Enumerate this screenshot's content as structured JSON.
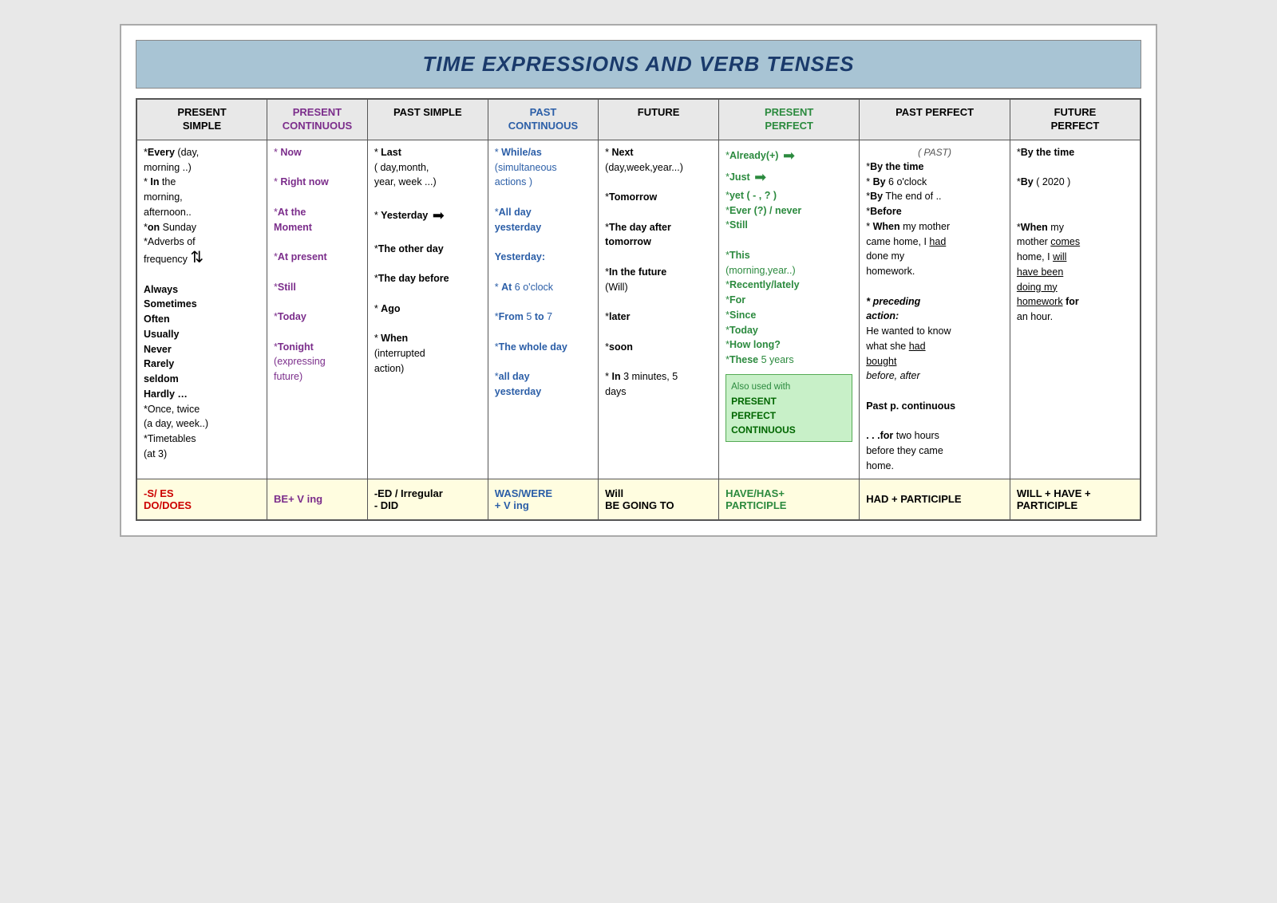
{
  "title": "TIME EXPRESSIONS AND VERB TENSES",
  "columns": [
    {
      "id": "present_simple",
      "header1": "PRESENT",
      "header2": "SIMPLE",
      "color": "#000"
    },
    {
      "id": "present_cont",
      "header1": "PRESENT",
      "header2": "CONTINUOUS",
      "color": "#7b2d8b"
    },
    {
      "id": "past_simple",
      "header1": "PAST SIMPLE",
      "header2": "",
      "color": "#000"
    },
    {
      "id": "past_cont",
      "header1": "PAST",
      "header2": "CONTINUOUS",
      "color": "#2b5ea7"
    },
    {
      "id": "future",
      "header1": "FUTURE",
      "header2": "",
      "color": "#000"
    },
    {
      "id": "present_perf",
      "header1": "PRESENT",
      "header2": "PERFECT",
      "color": "#2b8a3e"
    },
    {
      "id": "past_perf",
      "header1": "PAST PERFECT",
      "header2": "",
      "color": "#000"
    },
    {
      "id": "future_perf",
      "header1": "FUTURE",
      "header2": "PERFECT",
      "color": "#000"
    }
  ],
  "bottom_row": [
    {
      "text": "-S/ ES\nDO/DOES",
      "color": "#cc0000"
    },
    {
      "text": "BE+ V ing",
      "color": "#7b2d8b"
    },
    {
      "text": "-ED / Irregular\n- DID",
      "color": "#000"
    },
    {
      "text": "WAS/WERE\n+ V ing",
      "color": "#2b5ea7"
    },
    {
      "text": "Will\nBE GOING TO",
      "color": "#000"
    },
    {
      "text": "HAVE/HAS+\nPARTICIPLE",
      "color": "#2b8a3e"
    },
    {
      "text": "HAD + PARTICIPLE",
      "color": "#000"
    },
    {
      "text": "WILL + HAVE +\nPARTICIPLE",
      "color": "#000"
    }
  ]
}
